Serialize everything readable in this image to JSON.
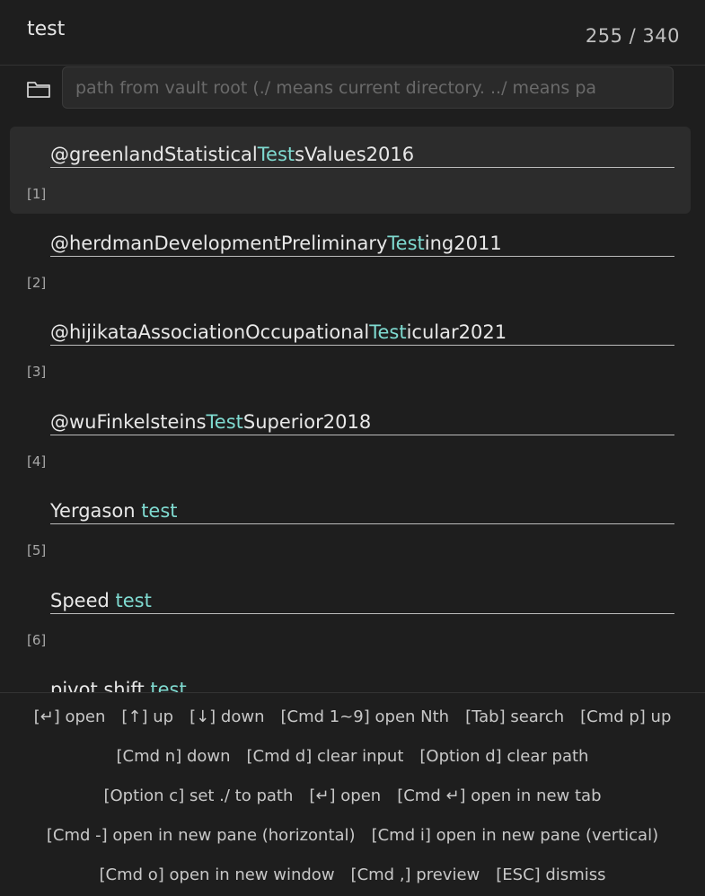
{
  "header": {
    "query": "test",
    "count": "255 / 340"
  },
  "path": {
    "placeholder": "path from vault root (./ means current directory. ../ means pa"
  },
  "results": [
    {
      "index": "[1]",
      "pre": "@greenlandStatistical",
      "hl": "Test",
      "post": "sValues2016",
      "selected": true
    },
    {
      "index": "[2]",
      "pre": "@herdmanDevelopmentPreliminary",
      "hl": "Test",
      "post": "ing2011"
    },
    {
      "index": "[3]",
      "pre": "@hijikataAssociationOccupational",
      "hl": "Test",
      "post": "icular2021"
    },
    {
      "index": "[4]",
      "pre": "@wuFinkelsteins",
      "hl": "Test",
      "post": "Superior2018"
    },
    {
      "index": "[5]",
      "pre": "Yergason ",
      "hl": "test",
      "post": ""
    },
    {
      "index": "[6]",
      "pre": "Speed ",
      "hl": "test",
      "post": ""
    },
    {
      "index": "",
      "pre": "pivot shift ",
      "hl": "test",
      "post": ""
    }
  ],
  "footer": {
    "lines": [
      [
        "[↵] open",
        "[↑] up",
        "[↓] down",
        "[Cmd 1~9] open Nth",
        "[Tab] search",
        "[Cmd p] up"
      ],
      [
        "[Cmd n] down",
        "[Cmd d] clear input",
        "[Option d] clear path"
      ],
      [
        "[Option c] set ./ to path",
        "[↵] open",
        "[Cmd ↵] open in new tab"
      ],
      [
        "[Cmd -] open in new pane (horizontal)",
        "[Cmd i] open in new pane (vertical)"
      ],
      [
        "[Cmd o] open in new window",
        "[Cmd ,] preview",
        "[ESC] dismiss"
      ]
    ]
  },
  "icons": {
    "folder": "folder-icon"
  },
  "colors": {
    "background": "#1e1e1e",
    "highlight": "#7fdad0",
    "selected": "#2c2c2c"
  }
}
